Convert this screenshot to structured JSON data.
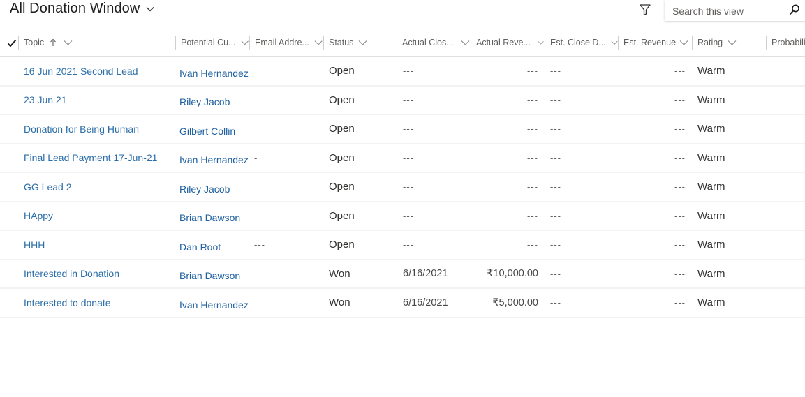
{
  "header": {
    "view_title": "All Donation Window",
    "search_placeholder": "Search this view"
  },
  "icons": {
    "view_selector": "chevron-down-icon",
    "filter": "filter-icon",
    "search": "search-icon",
    "select_all": "checkmark-icon",
    "sort_asc": "arrow-up-icon",
    "column_menu": "chevron-down-icon"
  },
  "columns": [
    {
      "key": "topic",
      "label": "Topic",
      "sorted": "ascending"
    },
    {
      "key": "potential_customer",
      "label": "Potential Cu..."
    },
    {
      "key": "email",
      "label": "Email Addre..."
    },
    {
      "key": "status",
      "label": "Status"
    },
    {
      "key": "actual_close",
      "label": "Actual Clos..."
    },
    {
      "key": "actual_revenue",
      "label": "Actual Reve..."
    },
    {
      "key": "est_close",
      "label": "Est. Close D..."
    },
    {
      "key": "est_revenue",
      "label": "Est. Revenue"
    },
    {
      "key": "rating",
      "label": "Rating"
    },
    {
      "key": "probability",
      "label": "Probabili"
    }
  ],
  "rows": [
    {
      "topic": "16 Jun 2021 Second Lead",
      "potential_customer": "Ivan Hernandez",
      "email": "",
      "status": "Open",
      "actual_close": "---",
      "actual_revenue": "---",
      "est_close": "---",
      "est_revenue": "---",
      "rating": "Warm"
    },
    {
      "topic": "23 Jun 21",
      "potential_customer": "Riley Jacob",
      "email": "",
      "status": "Open",
      "actual_close": "---",
      "actual_revenue": "---",
      "est_close": "---",
      "est_revenue": "---",
      "rating": "Warm"
    },
    {
      "topic": "Donation for Being Human",
      "potential_customer": "Gilbert Collin",
      "email": "",
      "status": "Open",
      "actual_close": "---",
      "actual_revenue": "---",
      "est_close": "---",
      "est_revenue": "---",
      "rating": "Warm"
    },
    {
      "topic": "Final Lead Payment 17-Jun-21",
      "potential_customer": "Ivan Hernandez",
      "email": "-",
      "status": "Open",
      "actual_close": "---",
      "actual_revenue": "---",
      "est_close": "---",
      "est_revenue": "---",
      "rating": "Warm"
    },
    {
      "topic": "GG Lead 2",
      "potential_customer": "Riley Jacob",
      "email": "",
      "status": "Open",
      "actual_close": "---",
      "actual_revenue": "---",
      "est_close": "---",
      "est_revenue": "---",
      "rating": "Warm"
    },
    {
      "topic": "HAppy",
      "potential_customer": "Brian Dawson",
      "email": "",
      "status": "Open",
      "actual_close": "---",
      "actual_revenue": "---",
      "est_close": "---",
      "est_revenue": "---",
      "rating": "Warm"
    },
    {
      "topic": "HHH",
      "potential_customer": "Dan Root",
      "email": "---",
      "status": "Open",
      "actual_close": "---",
      "actual_revenue": "---",
      "est_close": "---",
      "est_revenue": "---",
      "rating": "Warm"
    },
    {
      "topic": "Interested in Donation",
      "potential_customer": "Brian Dawson",
      "email": "",
      "status": "Won",
      "actual_close": "6/16/2021",
      "actual_revenue": "₹10,000.00",
      "est_close": "---",
      "est_revenue": "---",
      "rating": "Warm"
    },
    {
      "topic": "Interested to donate",
      "potential_customer": "Ivan Hernandez",
      "email": "",
      "status": "Won",
      "actual_close": "6/16/2021",
      "actual_revenue": "₹5,000.00",
      "est_close": "---",
      "est_revenue": "---",
      "rating": "Warm"
    }
  ]
}
